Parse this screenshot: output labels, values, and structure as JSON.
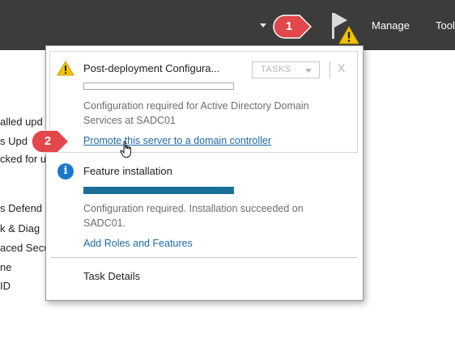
{
  "toolbar": {
    "menu_manage": "Manage",
    "menu_tools": "Tool",
    "flag_icon": "notifications-flag-icon",
    "warning_icon": "warning-icon"
  },
  "badges": {
    "step1": "1",
    "step2": "2",
    "color": "#e2474b"
  },
  "background_lines": [
    "alled upd",
    "s Upd",
    "cked for u",
    "s Defend",
    "k & Diag",
    "aced Secu",
    "ne",
    "ID"
  ],
  "notifications": [
    {
      "icon": "warning-icon",
      "title": "Post-deployment Configura...",
      "tasks_label": "TASKS",
      "close_label": "X",
      "progress": 0,
      "message_lines": [
        "Configuration required for Active Directory Domain",
        "Services at SADC01"
      ],
      "link": "Promote this server to a domain controller"
    },
    {
      "icon": "info-icon",
      "icon_glyph": "i",
      "title": "Feature installation",
      "progress": 1,
      "message_lines": [
        "Configuration required. Installation succeeded on",
        "SADC01."
      ],
      "link": "Add Roles and Features"
    }
  ],
  "task_details": "Task Details",
  "colors": {
    "toolbar_bg": "#3c3c3c",
    "link": "#1d6aa5",
    "progress_fill": "#1a6f97",
    "info": "#1b78c9",
    "warning": "#f5c400"
  }
}
